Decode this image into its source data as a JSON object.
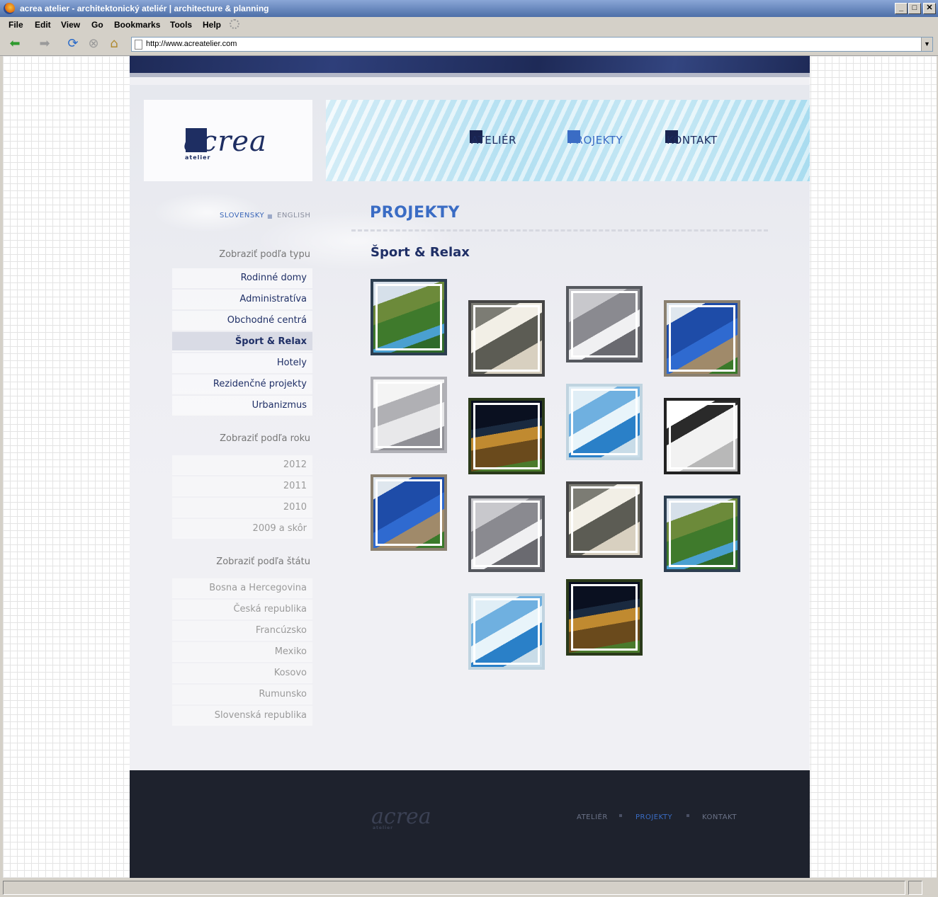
{
  "browser": {
    "title": "acrea atelier - architektonický ateliér  |  architecture & planning",
    "menu": [
      "File",
      "Edit",
      "View",
      "Go",
      "Bookmarks",
      "Tools",
      "Help"
    ],
    "url": "http://www.acreatelier.com"
  },
  "site": {
    "logo": "acrea",
    "logo_sub": "atelier",
    "nav": [
      "ATELIÉR",
      "PROJEKTY",
      "KONTAKT"
    ],
    "lang": {
      "sk": "SLOVENSKY",
      "en": "ENGLISH"
    }
  },
  "sidebar": {
    "type_heading": "Zobraziť podľa typu",
    "types": [
      "Rodinné domy",
      "Administratíva",
      "Obchodné centrá",
      "Šport & Relax",
      "Hotely",
      "Rezidenčné projekty",
      "Urbanizmus"
    ],
    "year_heading": "Zobraziť podľa roku",
    "years": [
      "2012",
      "2011",
      "2010",
      "2009 a skôr"
    ],
    "state_heading": "Zobraziť podľa štátu",
    "states": [
      "Bosna a Hercegovina",
      "Česká republika",
      "Francúzsko",
      "Mexiko",
      "Kosovo",
      "Rumunsko",
      "Slovenská republika"
    ]
  },
  "main": {
    "title": "PROJEKTY",
    "subtitle": "Šport & Relax"
  },
  "footer": {
    "logo": "acrea",
    "logo_sub": "atelier",
    "nav": [
      "ATELIÉR",
      "PROJEKTY",
      "KONTAKT"
    ]
  }
}
